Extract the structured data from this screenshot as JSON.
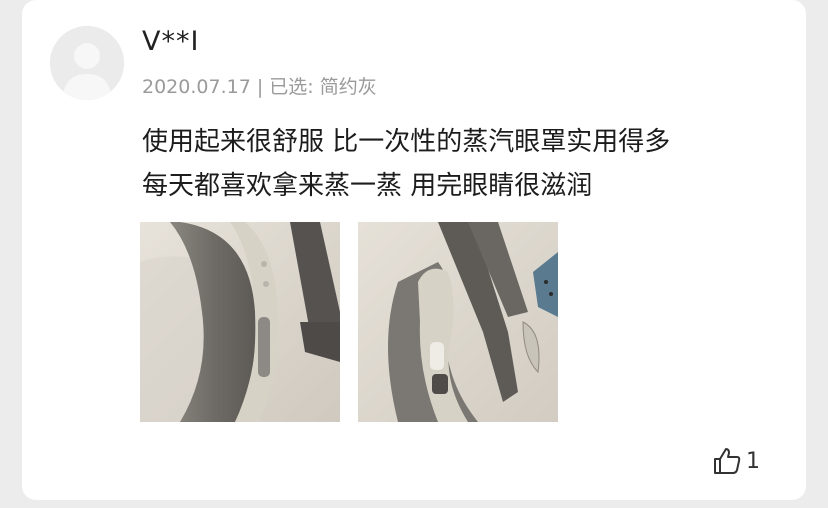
{
  "review": {
    "username": "V**I",
    "meta": "2020.07.17 | 已选: 简约灰",
    "text_lines": [
      "使用起来很舒服 比一次性的蒸汽眼罩实用得多",
      "每天都喜欢拿来蒸一蒸 用完眼睛很滋润"
    ],
    "photos": [
      "photo-1",
      "photo-2"
    ],
    "like_count": "1",
    "like_icon": "thumbs-up-icon",
    "avatar_icon": "default-avatar-icon"
  }
}
